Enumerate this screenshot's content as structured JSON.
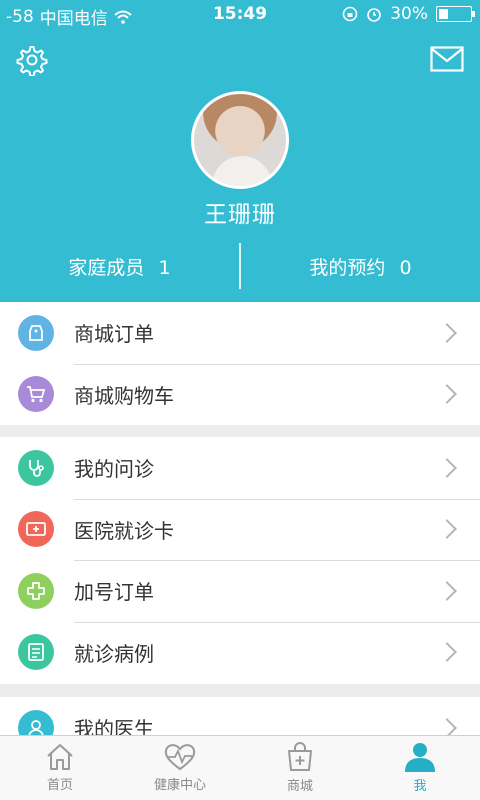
{
  "status_bar": {
    "signal": "-58",
    "carrier": "中国电信",
    "time": "15:49",
    "battery": "30%"
  },
  "colors": {
    "header_bg": "#33bcd2",
    "accent": "#26aec6"
  },
  "profile": {
    "name": "王珊珊",
    "family_label": "家庭成员",
    "family_count": "1",
    "appointment_label": "我的预约",
    "appointment_count": "0"
  },
  "menu_groups": [
    [
      {
        "label": "商城订单",
        "icon": "tag-icon",
        "color": "#5fb4e3"
      },
      {
        "label": "商城购物车",
        "icon": "cart-icon",
        "color": "#a98ad8"
      }
    ],
    [
      {
        "label": "我的问诊",
        "icon": "stethoscope-icon",
        "color": "#3cc6a0"
      },
      {
        "label": "医院就诊卡",
        "icon": "medical-card-icon",
        "color": "#f0675a"
      },
      {
        "label": "加号订单",
        "icon": "plus-cross-icon",
        "color": "#8fcf5e"
      },
      {
        "label": "就诊病例",
        "icon": "medical-record-icon",
        "color": "#3cc6a0"
      }
    ],
    [
      {
        "label": "我的医生",
        "icon": "doctor-icon",
        "color": "#33bcd2"
      }
    ]
  ],
  "tabs": [
    {
      "label": "首页",
      "icon": "home-icon",
      "active": false
    },
    {
      "label": "健康中心",
      "icon": "heart-pulse-icon",
      "active": false
    },
    {
      "label": "商城",
      "icon": "shopping-bag-icon",
      "active": false
    },
    {
      "label": "我",
      "icon": "user-icon",
      "active": true
    }
  ]
}
